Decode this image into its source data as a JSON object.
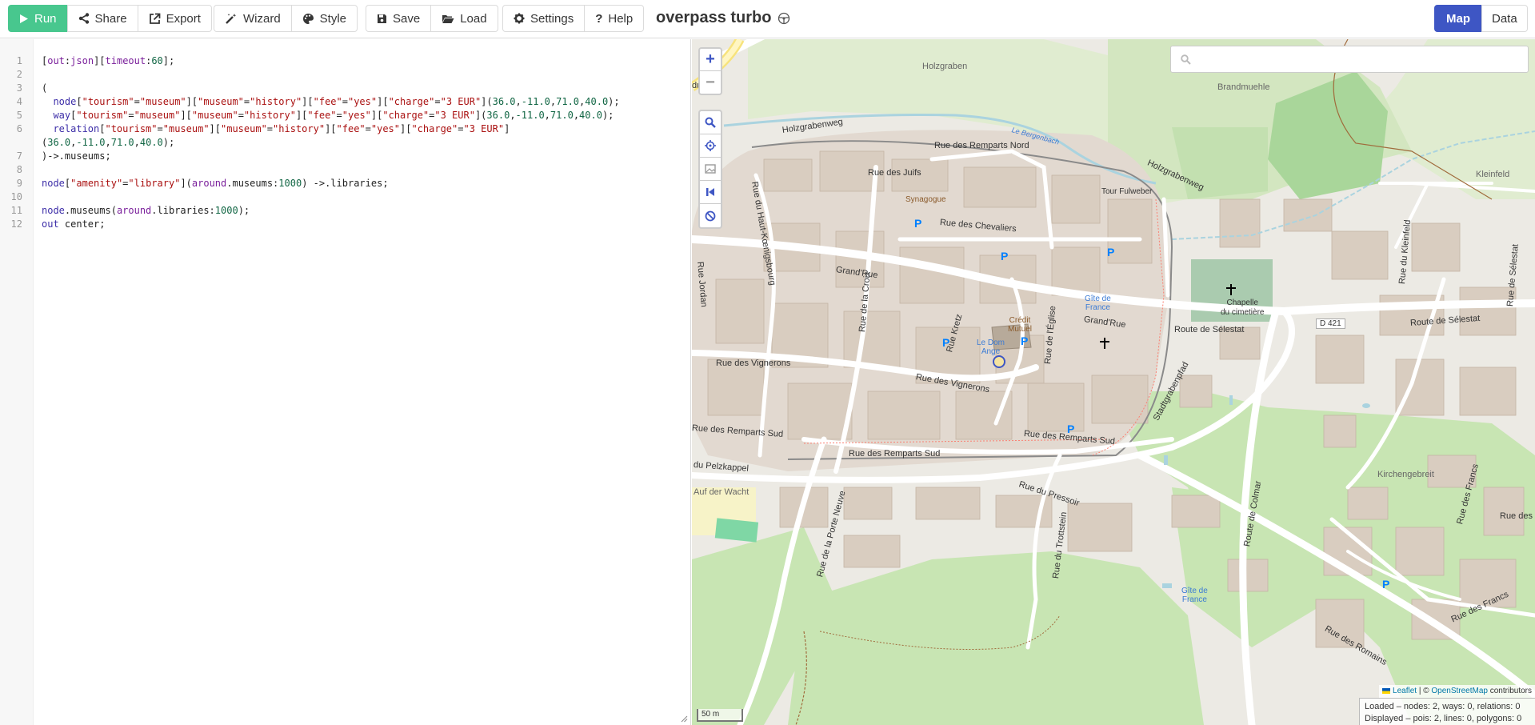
{
  "toolbar": {
    "run": "Run",
    "share": "Share",
    "export": "Export",
    "wizard": "Wizard",
    "style": "Style",
    "save": "Save",
    "load": "Load",
    "settings": "Settings",
    "help": "Help",
    "title": "overpass turbo",
    "map_tab": "Map",
    "data_tab": "Data",
    "accent_color": "#48c78e",
    "active_tab_color": "#3e56c4"
  },
  "editor": {
    "lines": [
      {
        "n": "1",
        "html": "[<span class='f'>out</span>:<span class='f'>json</span>][<span class='f'>timeout</span>:<span class='n'>60</span>];"
      },
      {
        "n": "2",
        "html": ""
      },
      {
        "n": "3",
        "html": "("
      },
      {
        "n": "4",
        "html": "  <span class='k'>node</span>[<span class='s'>\"tourism\"</span>=<span class='s'>\"museum\"</span>][<span class='s'>\"museum\"</span>=<span class='s'>\"history\"</span>][<span class='s'>\"fee\"</span>=<span class='s'>\"yes\"</span>][<span class='s'>\"charge\"</span>=<span class='s'>\"3 EUR\"</span>](<span class='n'>36.0</span>,<span class='n'>-11.0</span>,<span class='n'>71.0</span>,<span class='n'>40.0</span>);"
      },
      {
        "n": "5",
        "html": "  <span class='k'>way</span>[<span class='s'>\"tourism\"</span>=<span class='s'>\"museum\"</span>][<span class='s'>\"museum\"</span>=<span class='s'>\"history\"</span>][<span class='s'>\"fee\"</span>=<span class='s'>\"yes\"</span>][<span class='s'>\"charge\"</span>=<span class='s'>\"3 EUR\"</span>](<span class='n'>36.0</span>,<span class='n'>-11.0</span>,<span class='n'>71.0</span>,<span class='n'>40.0</span>);"
      },
      {
        "n": "6",
        "html": "  <span class='k'>relation</span>[<span class='s'>\"tourism\"</span>=<span class='s'>\"museum\"</span>][<span class='s'>\"museum\"</span>=<span class='s'>\"history\"</span>][<span class='s'>\"fee\"</span>=<span class='s'>\"yes\"</span>][<span class='s'>\"charge\"</span>=<span class='s'>\"3 EUR\"</span>]\n(<span class='n'>36.0</span>,<span class='n'>-11.0</span>,<span class='n'>71.0</span>,<span class='n'>40.0</span>);",
        "wrap": true
      },
      {
        "n": "7",
        "html": ")->.museums;"
      },
      {
        "n": "8",
        "html": ""
      },
      {
        "n": "9",
        "html": "<span class='k'>node</span>[<span class='s'>\"amenity\"</span>=<span class='s'>\"library\"</span>](<span class='f'>around</span>.museums:<span class='n'>1000</span>) ->.libraries;"
      },
      {
        "n": "10",
        "html": ""
      },
      {
        "n": "11",
        "html": "<span class='k'>node</span>.museums(<span class='f'>around</span>.libraries:<span class='n'>1000</span>);"
      },
      {
        "n": "12",
        "html": "<span class='k'>out</span> center;"
      }
    ]
  },
  "map": {
    "search_placeholder": "",
    "zoom_in": "+",
    "zoom_out": "−",
    "scale": "50 m",
    "attribution_leaflet": "Leaflet",
    "attribution_sep": " | © ",
    "attribution_osm": "OpenStreetMap",
    "attribution_tail": " contributors",
    "stats_loaded": "Loaded – nodes: 2, ways: 0, relations: 0",
    "stats_displayed": "Displayed – pois: 2, lines: 0, polygons: 0",
    "labels": {
      "holzgraben": "Holzgraben",
      "brandmuehle": "Brandmuehle",
      "holzgrabenweg1": "Holzgrabenweg",
      "holzgrabenweg2": "Holzgrabenweg",
      "bergenbach": "Le Bergenbach",
      "remparts_nord": "Rue des Remparts Nord",
      "juifs": "Rue des Juifs",
      "synagogue": "Synagogue",
      "tour_fulweber": "Tour Fulweber",
      "kleinfeld": "Kleinfeld",
      "chevaliers": "Rue des Chevaliers",
      "grand_rue1": "Grand'Rue",
      "grand_rue2": "Grand'Rue",
      "haut_koenigsbourg": "Rue du Haut-Kœnigsbourg",
      "jordan": "Rue Jordan",
      "gite1": "Gîte de\nFrance",
      "chapelle": "Chapelle\ndu cimetière",
      "credit_mutuel": "Crédit\nMutuel",
      "dom_ange": "Le Dom\nAnge",
      "route_selestat1": "Route de Sélestat",
      "route_selestat2": "Route de Sélestat",
      "d421": "D 421",
      "rue_croix": "Rue de la Croix",
      "rue_kretz": "Rue Kretz",
      "rue_eglise": "Rue de l'Église",
      "vignerons1": "Rue des Vignerons",
      "vignerons2": "Rue des Vignerons",
      "remparts_sud1": "Rue des Remparts Sud",
      "remparts_sud2": "Rue des Remparts Sud",
      "remparts_sud3": "Rue des Remparts Sud",
      "stadtgrabenpfad": "Stadtgrabenpfad",
      "pelzkappel": "du Pelzkappel",
      "pressoir": "Rue du Pressoir",
      "auf_der_wacht": "Auf der Wacht",
      "porte_neuve": "Rue de la Porte Neuve",
      "trottstein": "Rue du Trottstein",
      "route_colmar": "Route de Colmar",
      "kirchengebreit": "Kirchengebreit",
      "francs1": "Rue des Francs",
      "francs2": "Rue des Francs",
      "francs3": "Rue des Francs",
      "romains": "Rue des Romains",
      "rue_kleinfeld": "Rue du Kleinfeld",
      "rue_selestat": "Rue de Sélestat",
      "gite2": "Gîte de\nFrance",
      "du": "du"
    }
  }
}
